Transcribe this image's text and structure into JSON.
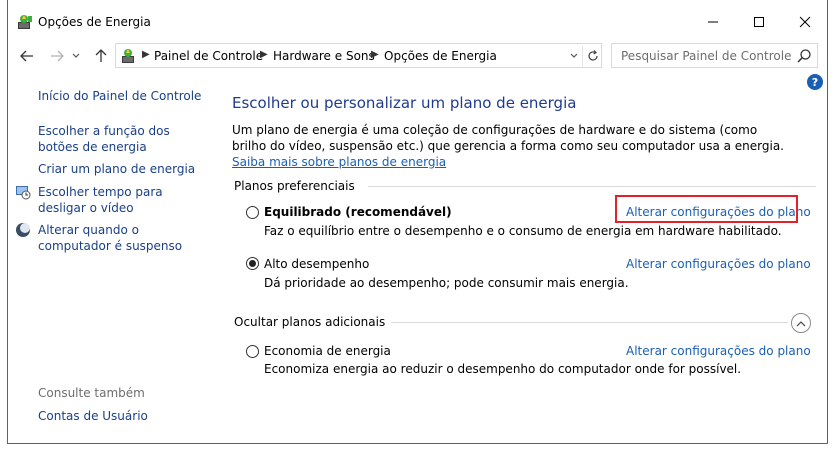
{
  "window": {
    "title": "Opções de Energia"
  },
  "address": {
    "crumbs": [
      "Painel de Controle",
      "Hardware e Sons",
      "Opções de Energia"
    ]
  },
  "search": {
    "placeholder": "Pesquisar Painel de Controle"
  },
  "help": {
    "label": "?"
  },
  "sidebar": {
    "home": "Início do Painel de Controle",
    "links": [
      "Escolher a função dos botões de energia",
      "Criar um plano de energia",
      "Escolher tempo para desligar o vídeo",
      "Alterar quando o computador é suspenso"
    ],
    "see_also_label": "Consulte também",
    "see_also": [
      "Contas de Usuário"
    ]
  },
  "main": {
    "title": "Escolher ou personalizar um plano de energia",
    "description": "Um plano de energia é uma coleção de configurações de hardware e do sistema (como brilho do vídeo, suspensão etc.) que gerencia a forma como seu computador usa a energia.",
    "learn_more": "Saiba mais sobre planos de energia",
    "preferred_label": "Planos preferenciais",
    "additional_label": "Ocultar planos adicionais",
    "plans": [
      {
        "name": "Equilibrado (recomendável)",
        "description": "Faz o equilíbrio entre o desempenho e o consumo de energia em hardware habilitado.",
        "link": "Alterar configurações do plano",
        "selected": false
      },
      {
        "name": "Alto desempenho",
        "description": "Dá prioridade ao desempenho; pode consumir mais energia.",
        "link": "Alterar configurações do plano",
        "selected": true
      },
      {
        "name": "Economia de energia",
        "description": "Economiza energia ao reduzir o desempenho do computador onde for possível.",
        "link": "Alterar configurações do plano",
        "selected": false
      }
    ]
  },
  "colors": {
    "link": "#1a5fb4",
    "title": "#1f3b8f",
    "highlight": "#e0232b"
  }
}
